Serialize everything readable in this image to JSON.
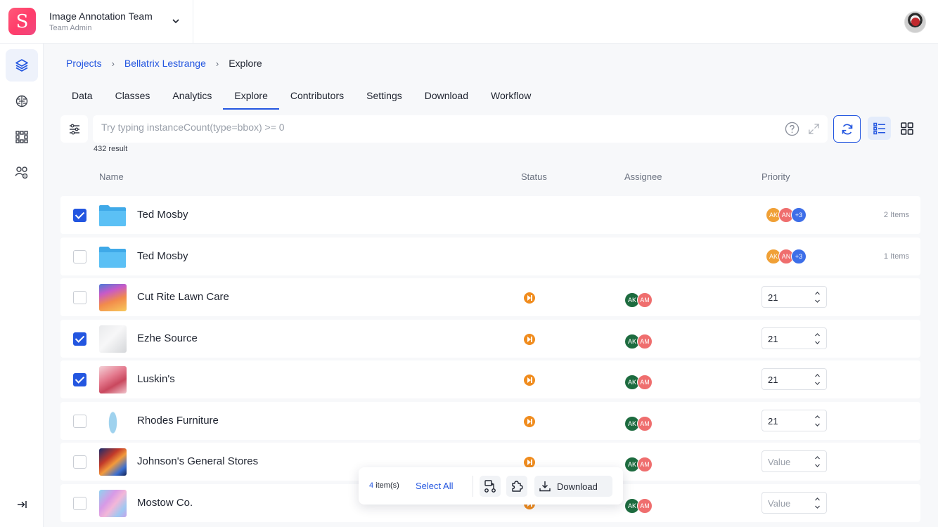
{
  "team": {
    "logo_letter": "S",
    "name": "Image Annotation Team",
    "role": "Team Admin"
  },
  "breadcrumb": {
    "projects": "Projects",
    "project": "Bellatrix Lestrange",
    "current": "Explore",
    "sep": "›"
  },
  "tabs": [
    "Data",
    "Classes",
    "Analytics",
    "Explore",
    "Contributors",
    "Settings",
    "Download",
    "Workflow"
  ],
  "active_tab": "Explore",
  "query": {
    "placeholder": "Try typing instanceCount(type=bbox) >= 0",
    "value": ""
  },
  "result_count": "432 result",
  "columns": {
    "name": "Name",
    "status": "Status",
    "assignee": "Assignee",
    "priority": "Priority"
  },
  "rows": [
    {
      "name": "Ted Mosby",
      "kind": "folder",
      "checked": true,
      "contributors": [
        "AK",
        "AN",
        "+3"
      ],
      "items": "2 Items"
    },
    {
      "name": "Ted Mosby",
      "kind": "folder",
      "checked": false,
      "contributors": [
        "AK",
        "AN",
        "+3"
      ],
      "items": "1 Items"
    },
    {
      "name": "Cut Rite Lawn Care",
      "kind": "image",
      "checked": false,
      "assignees": [
        "AK",
        "AM"
      ],
      "priority": "21"
    },
    {
      "name": "Ezhe Source",
      "kind": "image",
      "checked": true,
      "assignees": [
        "AK",
        "AM"
      ],
      "priority": "21"
    },
    {
      "name": "Luskin's",
      "kind": "image",
      "checked": true,
      "assignees": [
        "AK",
        "AM"
      ],
      "priority": "21"
    },
    {
      "name": "Rhodes Furniture",
      "kind": "image",
      "checked": false,
      "assignees": [
        "AK",
        "AM"
      ],
      "priority": "21"
    },
    {
      "name": "Johnson's General Stores",
      "kind": "image",
      "checked": false,
      "assignees": [
        "AK",
        "AM"
      ],
      "priority_placeholder": "Value"
    },
    {
      "name": "Mostow Co.",
      "kind": "image",
      "checked": false,
      "assignees": [
        "AK",
        "AM"
      ],
      "priority_placeholder": "Value"
    }
  ],
  "actionbar": {
    "count": "4",
    "count_suffix": " item(s)",
    "select_all": "Select All",
    "download": "Download"
  },
  "colors": {
    "accent": "#2356e0",
    "status_orange": "#f08c1e",
    "brand_pink": "#ff4a72"
  }
}
